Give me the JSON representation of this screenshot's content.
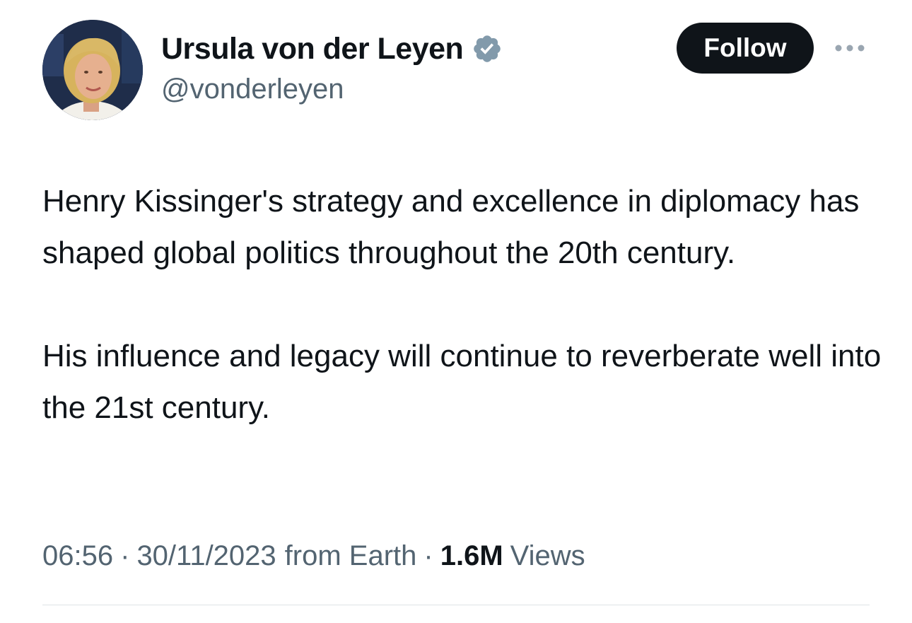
{
  "tweet": {
    "author": {
      "display_name": "Ursula von der Leyen",
      "handle": "@vonderleyen",
      "verified_icon": "verified-badge-icon",
      "avatar": "profile-photo"
    },
    "actions": {
      "follow_label": "Follow",
      "more_icon": "more-options-icon"
    },
    "paragraphs": [
      "Henry Kissinger's strategy and excellence in diplomacy has shaped global politics throughout the 20th century.",
      "His influence and legacy will continue to reverberate well into the 21st century."
    ],
    "meta": {
      "time": "06:56",
      "separator": "·",
      "date": "30/11/2023",
      "source": "from Earth",
      "views_count": "1.6M",
      "views_label": "Views"
    }
  },
  "colors": {
    "text_primary": "#0f1419",
    "text_secondary": "#536471",
    "follow_bg": "#0f1419",
    "verified_badge": "#829aab",
    "divider": "#dfe3e6"
  }
}
